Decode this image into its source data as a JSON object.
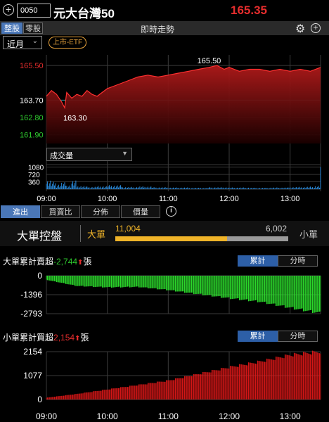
{
  "header": {
    "stock_code": "0050",
    "stock_name": "元大台灣50",
    "price": "165.35"
  },
  "tabs": {
    "whole": "整股",
    "odd": "零股",
    "title": "即時走勢"
  },
  "controls": {
    "period": "近月",
    "badge": "上市-ETF",
    "volume_select": "成交量"
  },
  "price_chart": {
    "y_labels": [
      {
        "text": "165.50",
        "color": "#e52d2d"
      },
      {
        "text": "163.70",
        "color": "#ffffff"
      },
      {
        "text": "162.80",
        "color": "#2ec82e"
      },
      {
        "text": "161.90",
        "color": "#2ec82e"
      }
    ],
    "high_label": "165.50",
    "low_label": "163.30",
    "vol_labels": [
      "1080",
      "720",
      "360"
    ],
    "x_labels": [
      "09:00",
      "10:00",
      "11:00",
      "12:00",
      "13:00"
    ]
  },
  "bottom_tabs": [
    "進出",
    "買賣比",
    "分佈",
    "價量"
  ],
  "control": {
    "title": "大單控盤",
    "big_label": "大單",
    "big_value": "11,004",
    "small_value": "6,002",
    "small_label": "小單",
    "big_ratio": 0.647
  },
  "big_panel": {
    "title_prefix": "大單累計賣超",
    "value": "-2,744",
    "unit": "張",
    "seg_cum": "累計",
    "seg_time": "分時",
    "y_labels": [
      "0",
      "-1396",
      "-2793"
    ],
    "x_labels": [
      "09:00",
      "10:00",
      "11:00",
      "12:00",
      "13:00"
    ]
  },
  "small_panel": {
    "title_prefix": "小單累計買超",
    "value": "2,154",
    "unit": "張",
    "seg_cum": "累計",
    "seg_time": "分時",
    "y_labels": [
      "2154",
      "1077",
      "0"
    ],
    "x_labels": [
      "09:00",
      "10:00",
      "11:00",
      "12:00",
      "13:00"
    ]
  },
  "colors": {
    "up": "#e52d2d",
    "down": "#2ec82e",
    "accent": "#f0b429",
    "active_tab": "#4a77b8"
  },
  "chart_data": [
    {
      "type": "area",
      "title": "即時走勢",
      "x_ticks": [
        "09:00",
        "10:00",
        "11:00",
        "12:00",
        "13:00"
      ],
      "y_ticks": [
        165.5,
        163.7,
        162.8,
        161.9
      ],
      "ylim": [
        161.45,
        166.05
      ],
      "reference": 163.7,
      "annotations": [
        {
          "label": "165.50",
          "time": "11:48"
        },
        {
          "label": "163.30",
          "time": "09:18"
        }
      ],
      "series": [
        {
          "x": [
            "09:00",
            "09:05",
            "09:10",
            "09:15",
            "09:18",
            "09:20",
            "09:25",
            "09:30",
            "09:35",
            "09:40",
            "09:45",
            "09:50",
            "09:55",
            "10:00",
            "10:10",
            "10:20",
            "10:30",
            "10:40",
            "10:50",
            "11:00",
            "11:10",
            "11:20",
            "11:30",
            "11:40",
            "11:48",
            "11:55",
            "12:00",
            "12:10",
            "12:20",
            "12:30",
            "12:40",
            "12:50",
            "13:00",
            "13:10",
            "13:20",
            "13:30"
          ],
          "values": [
            163.9,
            164.2,
            164.0,
            163.6,
            163.3,
            164.1,
            163.8,
            164.0,
            163.9,
            164.2,
            164.0,
            163.9,
            164.1,
            164.3,
            164.5,
            164.7,
            164.9,
            165.0,
            164.9,
            165.0,
            165.1,
            165.2,
            165.3,
            165.4,
            165.5,
            165.3,
            165.4,
            165.2,
            165.3,
            165.3,
            165.2,
            165.3,
            165.2,
            165.3,
            165.2,
            165.4
          ]
        }
      ]
    },
    {
      "type": "bar",
      "title": "成交量",
      "y_ticks": [
        1080,
        720,
        360
      ],
      "ylim": [
        0,
        1200
      ],
      "x": [
        "09:00",
        "09:05",
        "09:10",
        "09:15",
        "09:20",
        "09:25",
        "09:30",
        "09:40",
        "09:50",
        "10:00",
        "10:15",
        "10:30",
        "10:45",
        "11:00",
        "11:20",
        "11:40",
        "12:00",
        "12:20",
        "12:40",
        "13:00",
        "13:15",
        "13:25",
        "13:30"
      ],
      "values": [
        320,
        260,
        180,
        240,
        150,
        300,
        120,
        90,
        110,
        140,
        80,
        100,
        70,
        60,
        50,
        70,
        60,
        50,
        60,
        80,
        90,
        120,
        1080
      ]
    },
    {
      "type": "bar",
      "title": "大單累計賣超",
      "ylim": [
        -2793,
        0
      ],
      "y_ticks": [
        0,
        -1396,
        -2793
      ],
      "x": [
        "09:00",
        "09:30",
        "10:00",
        "10:30",
        "11:00",
        "11:30",
        "12:00",
        "12:30",
        "13:00",
        "13:30"
      ],
      "values": [
        -300,
        -750,
        -850,
        -820,
        -1050,
        -1350,
        -1650,
        -1900,
        -2350,
        -2744
      ]
    },
    {
      "type": "bar",
      "title": "小單累計買超",
      "ylim": [
        0,
        2154
      ],
      "y_ticks": [
        2154,
        1077,
        0
      ],
      "x": [
        "09:00",
        "09:30",
        "10:00",
        "10:30",
        "11:00",
        "11:30",
        "12:00",
        "12:30",
        "13:00",
        "13:30"
      ],
      "values": [
        80,
        250,
        450,
        650,
        850,
        1150,
        1450,
        1700,
        2000,
        2154
      ]
    }
  ]
}
